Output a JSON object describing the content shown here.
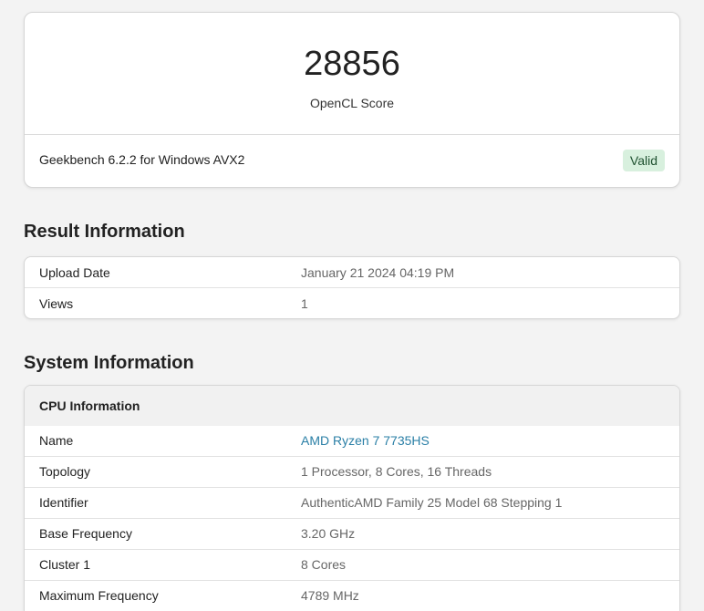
{
  "score": {
    "value": "28856",
    "label": "OpenCL Score",
    "version": "Geekbench 6.2.2 for Windows AVX2",
    "status": "Valid"
  },
  "result_info": {
    "title": "Result Information",
    "rows": [
      {
        "key": "Upload Date",
        "value": "January 21 2024 04:19 PM"
      },
      {
        "key": "Views",
        "value": "1"
      }
    ]
  },
  "system_info": {
    "title": "System Information",
    "cpu": {
      "heading": "CPU Information",
      "rows": [
        {
          "key": "Name",
          "value": "AMD Ryzen 7 7735HS"
        },
        {
          "key": "Topology",
          "value": "1 Processor, 8 Cores, 16 Threads"
        },
        {
          "key": "Identifier",
          "value": "AuthenticAMD Family 25 Model 68 Stepping 1"
        },
        {
          "key": "Base Frequency",
          "value": "3.20 GHz"
        },
        {
          "key": "Cluster 1",
          "value": "8 Cores"
        },
        {
          "key": "Maximum Frequency",
          "value": "4789 MHz"
        }
      ]
    }
  },
  "colors": {
    "background": "#f3f3f3",
    "link": "#2a7fa6",
    "badge_bg": "#d8f0de",
    "badge_text": "#1f5130"
  }
}
